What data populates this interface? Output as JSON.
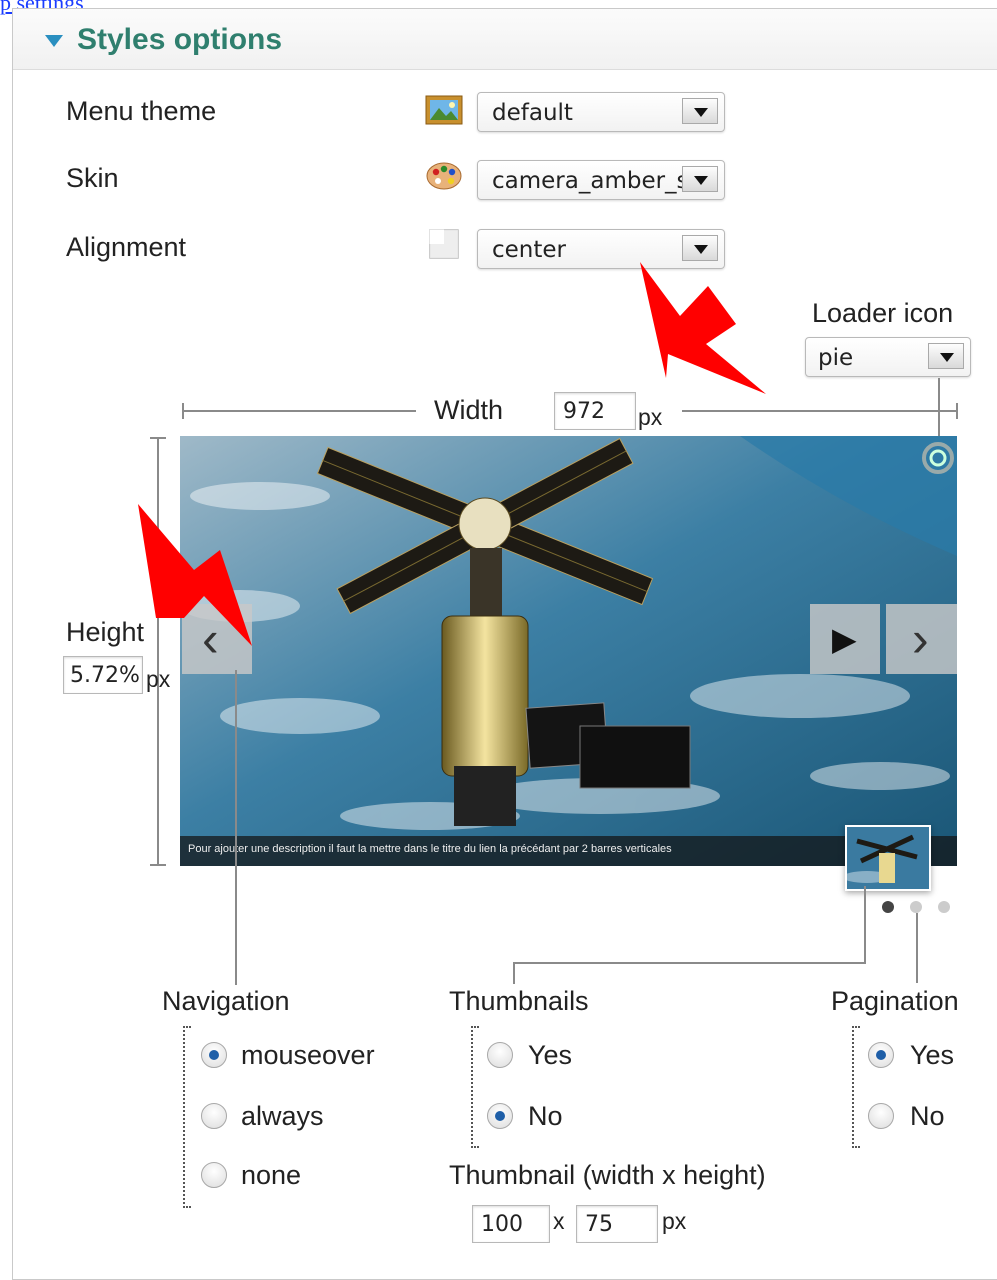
{
  "top_link": "p settings",
  "panel": {
    "title": "Styles options"
  },
  "fields": {
    "menu_theme": {
      "label": "Menu theme",
      "value": "default"
    },
    "skin": {
      "label": "Skin",
      "value": "camera_amber_s"
    },
    "alignment": {
      "label": "Alignment",
      "value": "center"
    },
    "loader_icon": {
      "label": "Loader icon",
      "value": "pie"
    }
  },
  "width": {
    "label": "Width",
    "value": "972",
    "unit": "px"
  },
  "height": {
    "label": "Height",
    "value": "5.72%",
    "unit": "px"
  },
  "slider": {
    "caption": "Pour ajouter une description il faut la mettre dans le titre du lien la précédant par 2 barres verticales",
    "prev_glyph": "‹",
    "play_glyph": "▶",
    "next_glyph": "›"
  },
  "navigation": {
    "label": "Navigation",
    "options": [
      {
        "label": "mouseover",
        "checked": true
      },
      {
        "label": "always",
        "checked": false
      },
      {
        "label": "none",
        "checked": false
      }
    ]
  },
  "thumbnails": {
    "label": "Thumbnails",
    "options": [
      {
        "label": "Yes",
        "checked": false
      },
      {
        "label": "No",
        "checked": true
      }
    ]
  },
  "pagination": {
    "label": "Pagination",
    "options": [
      {
        "label": "Yes",
        "checked": true
      },
      {
        "label": "No",
        "checked": false
      }
    ]
  },
  "thumbnail_size": {
    "label": "Thumbnail (width x height)",
    "width": "100",
    "separator": "x",
    "height": "75",
    "unit": "px"
  },
  "colors": {
    "header_title": "#2f7f6e",
    "accent_triangle": "#2a8fc0",
    "annotation_arrow": "#ff0000",
    "radio_dot": "#1f5fa8"
  },
  "icons": [
    "landscape-image-icon",
    "palette-icon",
    "alignment-icon",
    "loader-pie-icon",
    "prev-icon",
    "play-icon",
    "next-icon"
  ]
}
